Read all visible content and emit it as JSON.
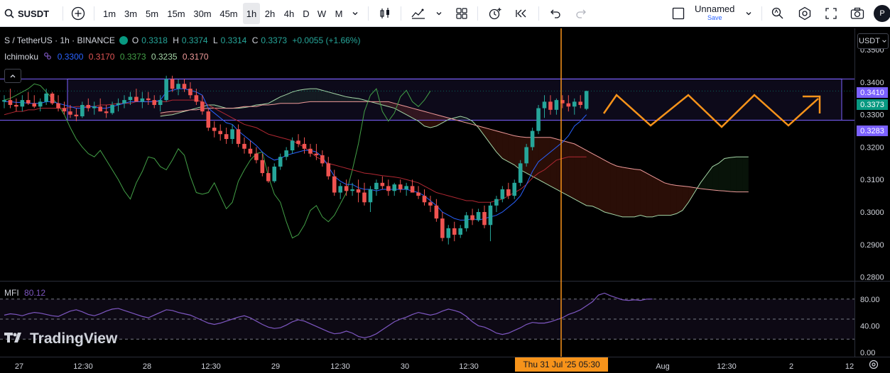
{
  "toolbar": {
    "symbol": "SUSDT",
    "timeframes": [
      "1m",
      "3m",
      "5m",
      "15m",
      "30m",
      "45m",
      "1h",
      "2h",
      "4h",
      "D",
      "W",
      "M"
    ],
    "active_timeframe": "1h",
    "layout_name": "Unnamed",
    "layout_save": "Save",
    "avatar_letter": "P",
    "icons": [
      "search-icon",
      "plus-circle-icon",
      "chevron-down-icon",
      "candles-icon",
      "indicators-icon",
      "chevron-down-icon",
      "layouts-icon",
      "alert-icon",
      "replay-icon",
      "undo-icon",
      "redo-icon",
      "square-icon",
      "chevron-down-icon",
      "quick-search-icon",
      "settings-icon",
      "fullscreen-icon",
      "camera-icon"
    ]
  },
  "legend": {
    "title": "S / TetherUS · 1h · BINANCE",
    "o_label": "O",
    "o": "0.3318",
    "h_label": "H",
    "h": "0.3374",
    "l_label": "L",
    "l": "0.3314",
    "c_label": "C",
    "c": "0.3373",
    "change": "+0.0055 (+1.66%)"
  },
  "ichimoku": {
    "name": "Ichimoku",
    "values": [
      "0.3300",
      "0.3170",
      "0.3373",
      "0.3235",
      "0.3170"
    ],
    "colors": [
      "#2962ff",
      "#b22833",
      "#43a047",
      "#a5d6a7",
      "#ef9a9a"
    ]
  },
  "mfi": {
    "name": "MFI",
    "value": "80.12",
    "color": "#7e57c2"
  },
  "currency": "USDT",
  "watermark": "TradingView",
  "price_tags": {
    "upper": "0.3410",
    "last": "0.3373",
    "lower": "0.3283"
  },
  "time_tag": "Thu 31 Jul '25   05:30",
  "colors": {
    "up": "#26a69a",
    "down": "#ef5350",
    "accent": "#f7931a",
    "box": "#7b61ff",
    "last": "#089981"
  },
  "chart_data": {
    "type": "candlestick",
    "y_ticks": [
      "0.3500",
      "0.3400",
      "0.3300",
      "0.3200",
      "0.3100",
      "0.3000",
      "0.2900",
      "0.2800"
    ],
    "y_range": [
      0.2788,
      0.3566
    ],
    "x_ticks": [
      "27",
      "12:30",
      "28",
      "12:30",
      "29",
      "12:30",
      "30",
      "12:30",
      "Aug",
      "12:30",
      "2",
      "12"
    ],
    "mfi_ticks": [
      "80.00",
      "40.00",
      "0.00"
    ],
    "candles": [
      [
        0.334,
        0.336,
        0.332,
        0.3345
      ],
      [
        0.3345,
        0.338,
        0.332,
        0.333
      ],
      [
        0.333,
        0.335,
        0.331,
        0.3325
      ],
      [
        0.3325,
        0.336,
        0.331,
        0.3345
      ],
      [
        0.3345,
        0.337,
        0.333,
        0.3335
      ],
      [
        0.3335,
        0.336,
        0.332,
        0.3325
      ],
      [
        0.3325,
        0.335,
        0.331,
        0.334
      ],
      [
        0.334,
        0.338,
        0.333,
        0.3365
      ],
      [
        0.3365,
        0.337,
        0.333,
        0.3335
      ],
      [
        0.3335,
        0.336,
        0.331,
        0.332
      ],
      [
        0.332,
        0.334,
        0.33,
        0.331
      ],
      [
        0.331,
        0.333,
        0.329,
        0.33
      ],
      [
        0.33,
        0.332,
        0.328,
        0.3295
      ],
      [
        0.3295,
        0.334,
        0.329,
        0.333
      ],
      [
        0.333,
        0.335,
        0.331,
        0.332
      ],
      [
        0.332,
        0.334,
        0.33,
        0.3325
      ],
      [
        0.3325,
        0.335,
        0.331,
        0.331
      ],
      [
        0.331,
        0.333,
        0.329,
        0.3305
      ],
      [
        0.3305,
        0.334,
        0.33,
        0.333
      ],
      [
        0.333,
        0.335,
        0.331,
        0.3335
      ],
      [
        0.3335,
        0.336,
        0.332,
        0.3345
      ],
      [
        0.3345,
        0.337,
        0.333,
        0.3355
      ],
      [
        0.3355,
        0.338,
        0.334,
        0.334
      ],
      [
        0.334,
        0.337,
        0.332,
        0.335
      ],
      [
        0.335,
        0.337,
        0.333,
        0.3345
      ],
      [
        0.3345,
        0.336,
        0.332,
        0.333
      ],
      [
        0.333,
        0.336,
        0.331,
        0.3345
      ],
      [
        0.3345,
        0.342,
        0.334,
        0.341
      ],
      [
        0.341,
        0.342,
        0.337,
        0.338
      ],
      [
        0.338,
        0.341,
        0.336,
        0.3395
      ],
      [
        0.3395,
        0.341,
        0.337,
        0.338
      ],
      [
        0.338,
        0.34,
        0.335,
        0.336
      ],
      [
        0.336,
        0.338,
        0.333,
        0.334
      ],
      [
        0.334,
        0.336,
        0.33,
        0.331
      ],
      [
        0.331,
        0.332,
        0.325,
        0.326
      ],
      [
        0.326,
        0.328,
        0.323,
        0.325
      ],
      [
        0.325,
        0.327,
        0.322,
        0.324
      ],
      [
        0.324,
        0.326,
        0.321,
        0.3225
      ],
      [
        0.3225,
        0.327,
        0.321,
        0.3255
      ],
      [
        0.3255,
        0.327,
        0.32,
        0.321
      ],
      [
        0.321,
        0.323,
        0.318,
        0.3195
      ],
      [
        0.3195,
        0.322,
        0.317,
        0.318
      ],
      [
        0.318,
        0.32,
        0.315,
        0.316
      ],
      [
        0.316,
        0.318,
        0.311,
        0.312
      ],
      [
        0.312,
        0.314,
        0.309,
        0.3095
      ],
      [
        0.3095,
        0.315,
        0.309,
        0.314
      ],
      [
        0.314,
        0.318,
        0.313,
        0.317
      ],
      [
        0.317,
        0.32,
        0.316,
        0.319
      ],
      [
        0.319,
        0.323,
        0.318,
        0.322
      ],
      [
        0.322,
        0.324,
        0.32,
        0.321
      ],
      [
        0.321,
        0.323,
        0.318,
        0.3195
      ],
      [
        0.3195,
        0.321,
        0.317,
        0.318
      ],
      [
        0.318,
        0.321,
        0.316,
        0.3175
      ],
      [
        0.3175,
        0.319,
        0.314,
        0.315
      ],
      [
        0.315,
        0.317,
        0.31,
        0.311
      ],
      [
        0.311,
        0.313,
        0.305,
        0.306
      ],
      [
        0.306,
        0.309,
        0.304,
        0.308
      ],
      [
        0.308,
        0.31,
        0.305,
        0.3065
      ],
      [
        0.3065,
        0.309,
        0.305,
        0.307
      ],
      [
        0.307,
        0.31,
        0.303,
        0.306
      ],
      [
        0.306,
        0.309,
        0.302,
        0.303
      ],
      [
        0.303,
        0.308,
        0.3,
        0.307
      ],
      [
        0.307,
        0.31,
        0.305,
        0.309
      ],
      [
        0.309,
        0.311,
        0.307,
        0.308
      ],
      [
        0.308,
        0.31,
        0.305,
        0.3065
      ],
      [
        0.3065,
        0.309,
        0.305,
        0.3085
      ],
      [
        0.3085,
        0.31,
        0.306,
        0.307
      ],
      [
        0.307,
        0.309,
        0.305,
        0.308
      ],
      [
        0.308,
        0.31,
        0.306,
        0.306
      ],
      [
        0.306,
        0.308,
        0.304,
        0.305
      ],
      [
        0.305,
        0.307,
        0.302,
        0.303
      ],
      [
        0.303,
        0.305,
        0.3,
        0.302
      ],
      [
        0.302,
        0.304,
        0.297,
        0.298
      ],
      [
        0.298,
        0.3,
        0.291,
        0.292
      ],
      [
        0.292,
        0.296,
        0.29,
        0.295
      ],
      [
        0.295,
        0.297,
        0.291,
        0.293
      ],
      [
        0.293,
        0.296,
        0.292,
        0.295
      ],
      [
        0.295,
        0.3,
        0.294,
        0.299
      ],
      [
        0.299,
        0.301,
        0.296,
        0.2975
      ],
      [
        0.2975,
        0.301,
        0.297,
        0.3
      ],
      [
        0.3,
        0.302,
        0.295,
        0.296
      ],
      [
        0.296,
        0.303,
        0.291,
        0.302
      ],
      [
        0.302,
        0.305,
        0.3,
        0.304
      ],
      [
        0.304,
        0.308,
        0.303,
        0.307
      ],
      [
        0.307,
        0.309,
        0.304,
        0.305
      ],
      [
        0.305,
        0.31,
        0.304,
        0.309
      ],
      [
        0.309,
        0.316,
        0.308,
        0.315
      ],
      [
        0.315,
        0.321,
        0.314,
        0.32
      ],
      [
        0.32,
        0.326,
        0.319,
        0.325
      ],
      [
        0.325,
        0.333,
        0.324,
        0.332
      ],
      [
        0.332,
        0.336,
        0.329,
        0.334
      ],
      [
        0.334,
        0.336,
        0.33,
        0.3315
      ],
      [
        0.3315,
        0.335,
        0.33,
        0.3345
      ],
      [
        0.3345,
        0.336,
        0.332,
        0.3335
      ],
      [
        0.3335,
        0.336,
        0.331,
        0.3325
      ],
      [
        0.3325,
        0.335,
        0.33,
        0.334
      ],
      [
        0.334,
        0.336,
        0.332,
        0.333
      ],
      [
        0.3318,
        0.3374,
        0.3314,
        0.3373
      ]
    ],
    "tenkan": [
      0.334,
      0.334,
      0.3338,
      0.3338,
      0.3335,
      0.3335,
      0.3335,
      0.334,
      0.334,
      0.3335,
      0.333,
      0.3325,
      0.332,
      0.332,
      0.3325,
      0.3325,
      0.332,
      0.332,
      0.3325,
      0.333,
      0.3335,
      0.334,
      0.334,
      0.334,
      0.334,
      0.334,
      0.3345,
      0.337,
      0.3375,
      0.338,
      0.338,
      0.3375,
      0.337,
      0.336,
      0.332,
      0.3305,
      0.329,
      0.3275,
      0.327,
      0.325,
      0.3235,
      0.322,
      0.3205,
      0.3185,
      0.317,
      0.316,
      0.3165,
      0.3175,
      0.318,
      0.3185,
      0.319,
      0.319,
      0.3185,
      0.317,
      0.314,
      0.311,
      0.3095,
      0.3085,
      0.3085,
      0.3075,
      0.307,
      0.307,
      0.3065,
      0.307,
      0.307,
      0.307,
      0.307,
      0.307,
      0.3065,
      0.306,
      0.305,
      0.3035,
      0.302,
      0.3,
      0.299,
      0.298,
      0.2975,
      0.2975,
      0.298,
      0.2975,
      0.298,
      0.2985,
      0.299,
      0.3,
      0.3015,
      0.303,
      0.305,
      0.3085,
      0.3125,
      0.3155,
      0.317,
      0.3185,
      0.32,
      0.3215,
      0.3235,
      0.3265,
      0.328,
      0.33
    ],
    "kijun": [
      0.33,
      0.3305,
      0.331,
      0.331,
      0.3315,
      0.3315,
      0.332,
      0.332,
      0.332,
      0.332,
      0.332,
      0.3322,
      0.3325,
      0.3325,
      0.3325,
      0.3325,
      0.333,
      0.333,
      0.3332,
      0.3335,
      0.3335,
      0.3335,
      0.334,
      0.334,
      0.334,
      0.334,
      0.334,
      0.334,
      0.3345,
      0.3345,
      0.3345,
      0.3345,
      0.3345,
      0.334,
      0.333,
      0.332,
      0.331,
      0.33,
      0.329,
      0.328,
      0.327,
      0.3265,
      0.326,
      0.325,
      0.324,
      0.3235,
      0.323,
      0.3225,
      0.322,
      0.321,
      0.32,
      0.3185,
      0.317,
      0.316,
      0.315,
      0.3145,
      0.314,
      0.3135,
      0.313,
      0.3125,
      0.312,
      0.3118,
      0.3115,
      0.3112,
      0.311,
      0.3108,
      0.3105,
      0.31,
      0.3095,
      0.309,
      0.308,
      0.307,
      0.306,
      0.3055,
      0.305,
      0.3045,
      0.304,
      0.3035,
      0.3035,
      0.303,
      0.303,
      0.303,
      0.3035,
      0.304,
      0.305,
      0.306,
      0.307,
      0.3085,
      0.3105,
      0.312,
      0.313,
      0.3145,
      0.316,
      0.3165,
      0.317,
      0.317,
      0.317,
      0.317
    ],
    "chikou": [
      0.3345,
      0.335,
      0.336,
      0.337,
      0.338,
      0.3395,
      0.339,
      0.337,
      0.335,
      0.333,
      0.33,
      0.326,
      0.3225,
      0.32,
      0.318,
      0.317,
      0.319,
      0.316,
      0.313,
      0.31,
      0.3065,
      0.304,
      0.309,
      0.3125,
      0.317,
      0.3165,
      0.314,
      0.313,
      0.316,
      0.3195,
      0.3175,
      0.311,
      0.306,
      0.3055,
      0.306,
      0.309,
      0.305,
      0.301,
      0.303,
      0.3095,
      0.313,
      0.316,
      0.318,
      0.3185,
      0.311,
      0.3055,
      0.303,
      0.297,
      0.292,
      0.293,
      0.296,
      0.3005,
      0.302,
      0.2985,
      0.297,
      0.299,
      0.3025,
      0.306,
      0.313,
      0.321,
      0.331,
      0.336,
      0.338,
      0.331,
      0.328,
      0.3305,
      0.3355,
      0.3375,
      0.334,
      0.3325,
      0.3345,
      0.3373
    ],
    "span_a": [
      0.3295,
      0.3298,
      0.33,
      0.3305,
      0.331,
      0.3315,
      0.332,
      0.3325,
      0.333,
      0.333,
      0.3325,
      0.332,
      0.332,
      0.332,
      0.3322,
      0.3325,
      0.333,
      0.3332,
      0.3335,
      0.3345,
      0.3355,
      0.3362,
      0.337,
      0.3375,
      0.3378,
      0.338,
      0.338,
      0.3375,
      0.337,
      0.3365,
      0.336,
      0.3355,
      0.3352,
      0.335,
      0.3345,
      0.334,
      0.3335,
      0.333,
      0.3325,
      0.332,
      0.331,
      0.33,
      0.329,
      0.328,
      0.3265,
      0.326,
      0.3265,
      0.3275,
      0.3285,
      0.329,
      0.3295,
      0.329,
      0.328,
      0.326,
      0.3235,
      0.321,
      0.3185,
      0.3165,
      0.3155,
      0.3145,
      0.313,
      0.312,
      0.311,
      0.31,
      0.309,
      0.308,
      0.307,
      0.306,
      0.305,
      0.304,
      0.303,
      0.302,
      0.3018,
      0.301,
      0.3,
      0.2995,
      0.299,
      0.2985,
      0.2985,
      0.2985,
      0.299,
      0.2985,
      0.2985,
      0.299,
      0.299,
      0.299,
      0.2995,
      0.3005,
      0.303,
      0.306,
      0.309,
      0.3115,
      0.314,
      0.315,
      0.3165,
      0.3168,
      0.317,
      0.317,
      0.317
    ],
    "span_b": [
      0.3305,
      0.3308,
      0.331,
      0.331,
      0.3312,
      0.3315,
      0.3315,
      0.3318,
      0.332,
      0.332,
      0.332,
      0.332,
      0.332,
      0.3322,
      0.3325,
      0.3325,
      0.3325,
      0.333,
      0.333,
      0.3332,
      0.3335,
      0.3335,
      0.3335,
      0.3335,
      0.3338,
      0.334,
      0.334,
      0.334,
      0.334,
      0.334,
      0.334,
      0.334,
      0.334,
      0.334,
      0.334,
      0.334,
      0.334,
      0.334,
      0.334,
      0.3335,
      0.333,
      0.3325,
      0.332,
      0.3315,
      0.331,
      0.3305,
      0.33,
      0.3295,
      0.329,
      0.3285,
      0.328,
      0.3275,
      0.327,
      0.3265,
      0.326,
      0.3255,
      0.325,
      0.3245,
      0.324,
      0.3235,
      0.3232,
      0.323,
      0.323,
      0.323,
      0.323,
      0.323,
      0.3225,
      0.322,
      0.3215,
      0.321,
      0.32,
      0.319,
      0.318,
      0.317,
      0.316,
      0.315,
      0.3142,
      0.3138,
      0.3135,
      0.3132,
      0.313,
      0.312,
      0.311,
      0.31,
      0.309,
      0.3085,
      0.3082,
      0.308,
      0.3078,
      0.3075,
      0.3072,
      0.307,
      0.3068,
      0.3066,
      0.3065,
      0.3063,
      0.3062,
      0.3062,
      0.3062
    ],
    "mfi": [
      56,
      58,
      57,
      55,
      58,
      60,
      59,
      57,
      55,
      54,
      58,
      62,
      64,
      61,
      57,
      55,
      58,
      62,
      65,
      66,
      63,
      60,
      57,
      54,
      52,
      56,
      60,
      64,
      63,
      60,
      58,
      56,
      52,
      48,
      44,
      42,
      44,
      47,
      50,
      53,
      55,
      52,
      47,
      42,
      38,
      36,
      37,
      41,
      46,
      49,
      47,
      43,
      39,
      35,
      31,
      28,
      29,
      32,
      29,
      24,
      22,
      24,
      28,
      34,
      40,
      46,
      50,
      53,
      57,
      60,
      58,
      56,
      58,
      62,
      65,
      63,
      60,
      54,
      46,
      40,
      38,
      34,
      29,
      27,
      29,
      33,
      37,
      42,
      45,
      44,
      44,
      46,
      49,
      52,
      57,
      60,
      64,
      70,
      76,
      86,
      89,
      85,
      82,
      79,
      78,
      79,
      78,
      80,
      80.12
    ],
    "box": {
      "top": 0.341,
      "bottom": 0.3283
    },
    "marker_time": "Thu 31 Jul '25 05:30"
  }
}
